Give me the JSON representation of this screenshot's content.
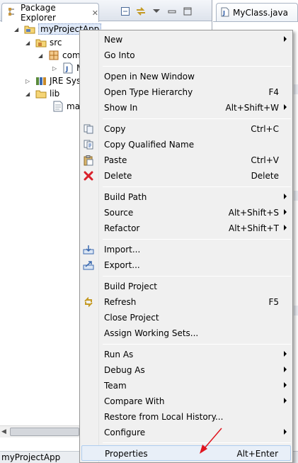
{
  "explorer": {
    "tab_title": "Package Explorer",
    "tree": [
      {
        "label": "myProjectApp",
        "icon": "project-folder-icon"
      },
      {
        "label": "src",
        "icon": "source-folder-icon"
      },
      {
        "label": "com",
        "icon": "package-icon"
      },
      {
        "label": "M",
        "icon": "java-file-icon"
      },
      {
        "label": "JRE Syst",
        "icon": "library-icon"
      },
      {
        "label": "lib",
        "icon": "folder-icon"
      },
      {
        "label": "man",
        "icon": "file-icon"
      }
    ]
  },
  "editor": {
    "tab_title": "MyClass.java"
  },
  "status": {
    "text": "myProjectApp"
  },
  "menu": {
    "items": [
      {
        "label": "New",
        "accel": "",
        "submenu": true
      },
      {
        "label": "Go Into",
        "accel": "",
        "submenu": false
      },
      {
        "label": "Open in New Window",
        "accel": "",
        "submenu": false
      },
      {
        "label": "Open Type Hierarchy",
        "accel": "F4",
        "submenu": false
      },
      {
        "label": "Show In",
        "accel": "Alt+Shift+W",
        "submenu": true
      },
      {
        "label": "Copy",
        "accel": "Ctrl+C",
        "submenu": false,
        "icon": "copy-icon"
      },
      {
        "label": "Copy Qualified Name",
        "accel": "",
        "submenu": false,
        "icon": "copy-qualified-name-icon"
      },
      {
        "label": "Paste",
        "accel": "Ctrl+V",
        "submenu": false,
        "icon": "paste-icon"
      },
      {
        "label": "Delete",
        "accel": "Delete",
        "submenu": false,
        "icon": "delete-icon"
      },
      {
        "label": "Build Path",
        "accel": "",
        "submenu": true
      },
      {
        "label": "Source",
        "accel": "Alt+Shift+S",
        "submenu": true
      },
      {
        "label": "Refactor",
        "accel": "Alt+Shift+T",
        "submenu": true
      },
      {
        "label": "Import...",
        "accel": "",
        "submenu": false,
        "icon": "import-icon"
      },
      {
        "label": "Export...",
        "accel": "",
        "submenu": false,
        "icon": "export-icon"
      },
      {
        "label": "Build Project",
        "accel": "",
        "submenu": false
      },
      {
        "label": "Refresh",
        "accel": "F5",
        "submenu": false,
        "icon": "refresh-icon"
      },
      {
        "label": "Close Project",
        "accel": "",
        "submenu": false
      },
      {
        "label": "Assign Working Sets...",
        "accel": "",
        "submenu": false
      },
      {
        "label": "Run As",
        "accel": "",
        "submenu": true
      },
      {
        "label": "Debug As",
        "accel": "",
        "submenu": true
      },
      {
        "label": "Team",
        "accel": "",
        "submenu": true
      },
      {
        "label": "Compare With",
        "accel": "",
        "submenu": true
      },
      {
        "label": "Restore from Local History...",
        "accel": "",
        "submenu": false
      },
      {
        "label": "Configure",
        "accel": "",
        "submenu": true
      },
      {
        "label": "Properties",
        "accel": "Alt+Enter",
        "submenu": false
      }
    ]
  },
  "colors": {
    "menu_bg": "#f0f0f0",
    "highlight_bg": "#e8eff8",
    "annotation_arrow": "#e0141e",
    "delete_icon": "#d9202a"
  }
}
